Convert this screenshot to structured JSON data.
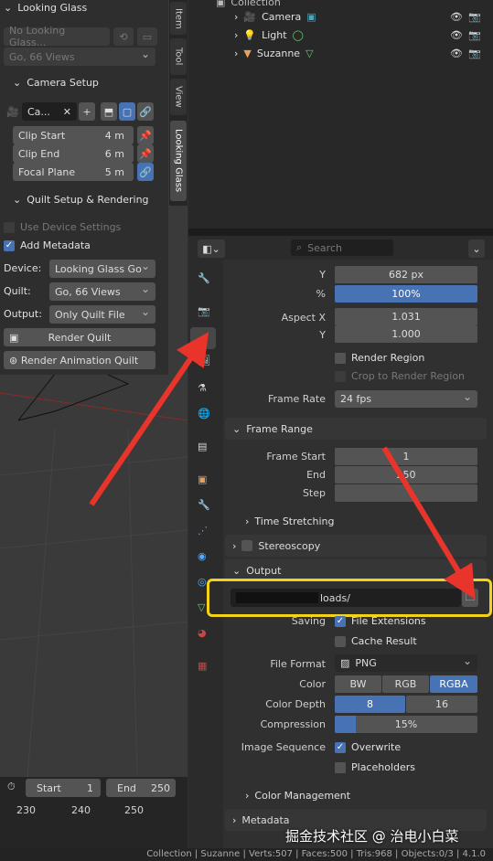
{
  "npanel": {
    "title": "Looking Glass",
    "device_placeholder": "No Looking Glass...",
    "quilt_preset_dim": "Go, 66 Views",
    "camera_setup": "Camera Setup",
    "camera_name": "Ca...",
    "clip_start_label": "Clip Start",
    "clip_start_val": "4 m",
    "clip_end_label": "Clip End",
    "clip_end_val": "6 m",
    "focal_plane_label": "Focal Plane",
    "focal_plane_val": "5 m",
    "quilt_setup": "Quilt Setup & Rendering",
    "use_device_settings": "Use Device Settings",
    "add_metadata": "Add Metadata",
    "device_label": "Device:",
    "device_val": "Looking Glass Go",
    "quilt_label": "Quilt:",
    "quilt_val": "Go, 66 Views",
    "output_label": "Output:",
    "output_val": "Only Quilt File",
    "render_quilt": "Render Quilt",
    "render_anim_quilt": "Render Animation Quilt"
  },
  "vtabs": [
    "Item",
    "Tool",
    "View",
    "Looking Glass"
  ],
  "outliner": {
    "collection": "Collection",
    "items": [
      {
        "name": "Camera"
      },
      {
        "name": "Light"
      },
      {
        "name": "Suzanne"
      }
    ]
  },
  "props": {
    "search_placeholder": "Search",
    "y_label": "Y",
    "y_val": "682 px",
    "pct_label": "%",
    "pct_val": "100%",
    "aspect_x_label": "Aspect X",
    "aspect_x_val": "1.031",
    "aspect_y_label": "Y",
    "aspect_y_val": "1.000",
    "render_region": "Render Region",
    "crop_region": "Crop to Render Region",
    "frame_rate_label": "Frame Rate",
    "frame_rate_val": "24 fps",
    "frame_range": "Frame Range",
    "frame_start_label": "Frame Start",
    "frame_start_val": "1",
    "end_label": "End",
    "end_val": "250",
    "step_label": "Step",
    "step_val": "",
    "time_stretching": "Time Stretching",
    "stereoscopy": "Stereoscopy",
    "output": "Output",
    "output_path": "loads/",
    "saving_label": "Saving",
    "file_extensions": "File Extensions",
    "cache_result": "Cache Result",
    "file_format_label": "File Format",
    "file_format_val": "PNG",
    "color_label": "Color",
    "color_bw": "BW",
    "color_rgb": "RGB",
    "color_rgba": "RGBA",
    "color_depth_label": "Color Depth",
    "depth_8": "8",
    "depth_16": "16",
    "compression_label": "Compression",
    "compression_val": "15%",
    "compression_fill": 0.15,
    "image_seq_label": "Image Sequence",
    "overwrite": "Overwrite",
    "placeholders": "Placeholders",
    "color_management": "Color Management",
    "metadata": "Metadata"
  },
  "timeline": {
    "start_label": "Start",
    "start_val": "1",
    "end_label": "End",
    "end_val": "250",
    "ticks": [
      "230",
      "240",
      "250"
    ]
  },
  "status": "Collection | Suzanne | Verts:507 | Faces:500 | Tris:968 | Objects:0/3 | 4.1.0",
  "watermark": "掘金技术社区 @ 治电小白菜",
  "colors": {
    "accent": "#4772b3",
    "arrow": "#e8342a",
    "highlight": "#f2d21a"
  }
}
